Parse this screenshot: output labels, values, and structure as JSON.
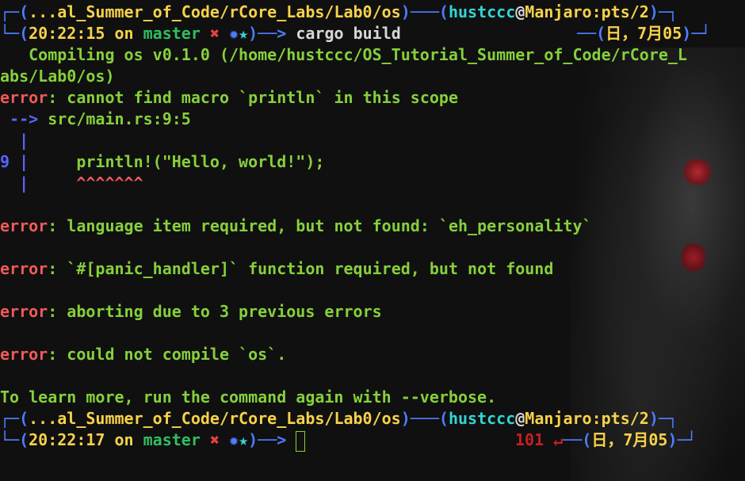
{
  "prompt1": {
    "path": "...al_Summer_of_Code/rCore_Labs/Lab0/os",
    "user": "hustccc",
    "host": "Manjaro:pts/2",
    "time": "20:22:15",
    "on_word": "on",
    "branch": "master",
    "status_x": "✖",
    "status_gear": "✹",
    "status_star": "★",
    "command": "cargo build",
    "date": "日，7月05"
  },
  "output": {
    "compiling": "   Compiling os v0.1.0 (/home/hustccc/OS_Tutorial_Summer_of_Code/rCore_L",
    "compiling_wrap": "abs/Lab0/os)",
    "err1_label": "error",
    "err1_msg": ": cannot find macro `println` in this scope",
    "err1_arrow": " -->",
    "err1_loc": " src/main.rs:9:5",
    "gutter_bar": "  |",
    "line_no": "9",
    "code": "     println!(\"Hello, world!\");",
    "carets": "     ^^^^^^^",
    "err2_label": "error",
    "err2_msg": ": language item required, but not found: `eh_personality`",
    "err3_label": "error",
    "err3_msg": ": `#[panic_handler]` function required, but not found",
    "err4_label": "error",
    "err4_msg": ": aborting due to 3 previous errors",
    "err5_label": "error",
    "err5_msg": ": could not compile `os`.",
    "learn_more": "To learn more, run the command again with --verbose."
  },
  "prompt2": {
    "path": "...al_Summer_of_Code/rCore_Labs/Lab0/os",
    "user": "hustccc",
    "host": "Manjaro:pts/2",
    "time": "20:22:17",
    "on_word": "on",
    "branch": "master",
    "status_x": "✖",
    "status_gear": "✹",
    "status_star": "★",
    "exit_code": "101",
    "return_icon": "↵",
    "date": "日，7月05"
  },
  "colors": {
    "frame": "#4f7cff",
    "error": "#f05a5a",
    "text_green": "#8ad13b",
    "user_cyan": "#32d6d6",
    "host_yellow": "#f7d24a"
  }
}
